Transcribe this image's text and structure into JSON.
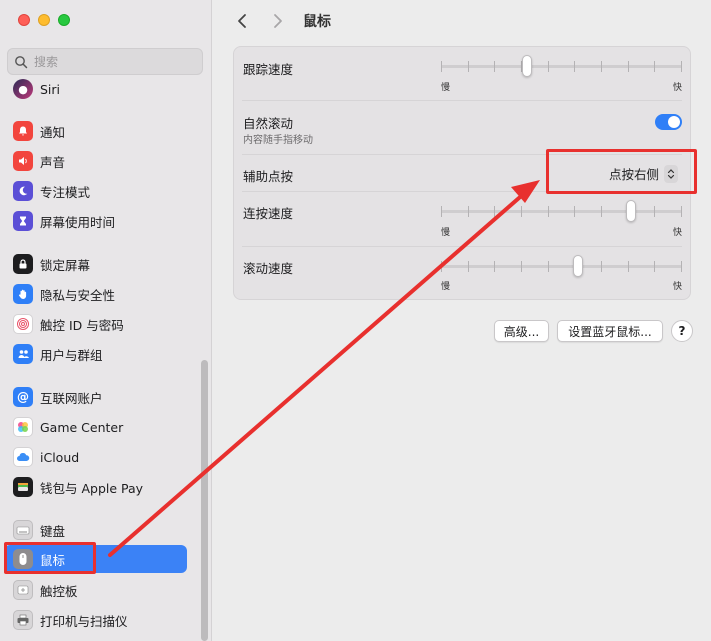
{
  "window": {
    "title": "鼠标"
  },
  "search": {
    "placeholder": "搜索"
  },
  "sidebar": {
    "items": [
      {
        "label": "Siri",
        "icon": "siri-icon",
        "color": "#1d1d3a"
      },
      {
        "label": "通知",
        "icon": "bell-icon",
        "color": "#f2453d"
      },
      {
        "label": "声音",
        "icon": "speaker-icon",
        "color": "#f2453d"
      },
      {
        "label": "专注模式",
        "icon": "moon-icon",
        "color": "#5b4fd6"
      },
      {
        "label": "屏幕使用时间",
        "icon": "hourglass-icon",
        "color": "#5b4fd6"
      },
      {
        "label": "锁定屏幕",
        "icon": "lock-icon",
        "color": "#1d1d1f"
      },
      {
        "label": "隐私与安全性",
        "icon": "hand-icon",
        "color": "#2f7ff7"
      },
      {
        "label": "触控 ID 与密码",
        "icon": "fingerprint-icon",
        "color": "#ffffff"
      },
      {
        "label": "用户与群组",
        "icon": "users-icon",
        "color": "#2f7ff7"
      },
      {
        "label": "互联网账户",
        "icon": "at-icon",
        "color": "#2f7ff7"
      },
      {
        "label": "Game Center",
        "icon": "game-center-icon",
        "color": "#ffffff"
      },
      {
        "label": "iCloud",
        "icon": "cloud-icon",
        "color": "#ffffff"
      },
      {
        "label": "钱包与 Apple Pay",
        "icon": "wallet-icon",
        "color": "#1d1d1f"
      },
      {
        "label": "键盘",
        "icon": "keyboard-icon",
        "color": "#d8d6d8"
      },
      {
        "label": "鼠标",
        "icon": "mouse-icon",
        "color": "#9a989a",
        "selected": true
      },
      {
        "label": "触控板",
        "icon": "trackpad-icon",
        "color": "#d8d6d8"
      },
      {
        "label": "打印机与扫描仪",
        "icon": "printer-icon",
        "color": "#d8d6d8"
      }
    ]
  },
  "settings": {
    "tracking": {
      "label": "跟踪速度",
      "min": "慢",
      "max": "快",
      "value": 0.35
    },
    "natural_scroll": {
      "label": "自然滚动",
      "sub": "内容随手指移动",
      "enabled": true
    },
    "secondary_click": {
      "label": "辅助点按",
      "value": "点按右侧"
    },
    "double_click": {
      "label": "连按速度",
      "min": "慢",
      "max": "快",
      "value": 0.8
    },
    "scroll_speed": {
      "label": "滚动速度",
      "min": "慢",
      "max": "快",
      "value": 0.57
    }
  },
  "buttons": {
    "advanced": "高级...",
    "bluetooth": "设置蓝牙鼠标...",
    "help": "?"
  },
  "colors": {
    "accent": "#3b82f6",
    "annotation": "#e8302e"
  }
}
